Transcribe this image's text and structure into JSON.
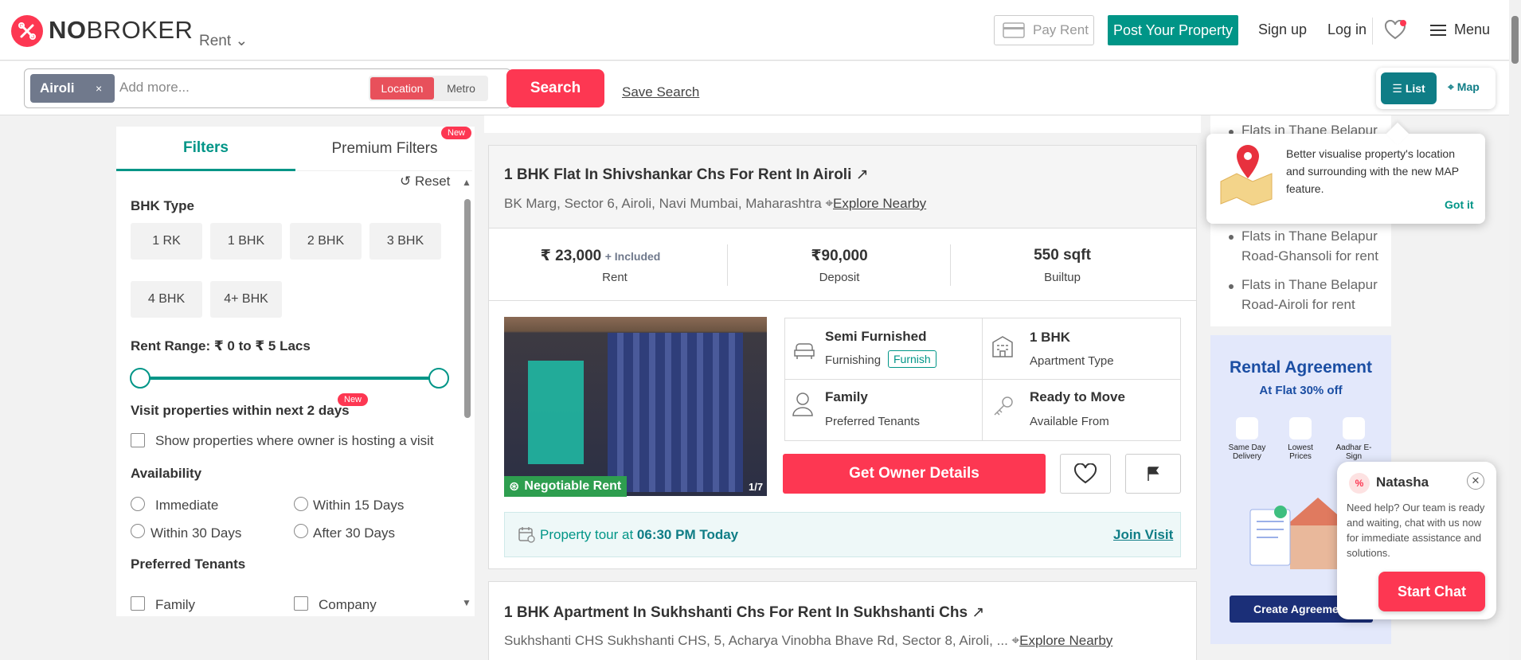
{
  "header": {
    "logo_text_bold": "NO",
    "logo_text_rest": "BROKER",
    "rent_dropdown": "Rent",
    "pay_rent": "Pay Rent",
    "post_property": "Post Your Property",
    "signup": "Sign up",
    "login": "Log in",
    "menu": "Menu"
  },
  "search": {
    "chip": "Airoli",
    "chip_remove": "×",
    "placeholder": "Add more...",
    "toggle_location": "Location",
    "toggle_metro": "Metro",
    "search_button": "Search",
    "save_search": "Save Search"
  },
  "view_toggle": {
    "list": "List",
    "map": "Map"
  },
  "filters": {
    "tab_filters": "Filters",
    "tab_premium": "Premium Filters",
    "new_badge": "New",
    "reset": "Reset",
    "bhk_title": "BHK Type",
    "bhk_options": [
      "1 RK",
      "1 BHK",
      "2 BHK",
      "3 BHK",
      "4 BHK",
      "4+ BHK"
    ],
    "rent_range": "Rent Range: ₹ 0 to ₹ 5 Lacs",
    "visit_title": "Visit properties within next 2 days",
    "visit_new": "New",
    "visit_checkbox": "Show properties where owner is hosting a visit",
    "availability_title": "Availability",
    "availability": [
      "Immediate",
      "Within 15 Days",
      "Within 30 Days",
      "After 30 Days"
    ],
    "tenants_title": "Preferred Tenants",
    "tenants": [
      "Family",
      "Company"
    ]
  },
  "listing1": {
    "title": "1 BHK Flat In Shivshankar Chs For Rent In Airoli",
    "address": "BK Marg, Sector 6, Airoli, Navi Mumbai, Maharashtra",
    "explore": "Explore Nearby",
    "rent_value": "₹ 23,000",
    "rent_included": "+ Included",
    "rent_label": "Rent",
    "deposit_value": "₹90,000",
    "deposit_label": "Deposit",
    "area_value": "550 sqft",
    "area_label": "Builtup",
    "negotiable": "Negotiable Rent",
    "photo_count": "1/7",
    "furnishing_value": "Semi Furnished",
    "furnishing_label": "Furnishing",
    "furnish_tag": "Furnish",
    "apt_value": "1 BHK",
    "apt_label": "Apartment Type",
    "tenant_value": "Family",
    "tenant_label": "Preferred Tenants",
    "avail_value": "Ready to Move",
    "avail_label": "Available From",
    "owner_button": "Get Owner Details",
    "tour_prefix": "Property tour at",
    "tour_time": "06:30 PM Today",
    "join_visit": "Join Visit"
  },
  "listing2": {
    "title": "1 BHK Apartment In Sukhshanti Chs For Rent In Sukhshanti Chs",
    "address": "Sukhshanti CHS  Sukhshanti CHS, 5, Acharya Vinobha Bhave Rd, Sector 8, Airoli, ...",
    "explore": "Explore Nearby"
  },
  "sidebar": {
    "links": [
      "Flats in Thane Belapur",
      "Flats in Thane Belapur Road-Ghansoli for rent",
      "Flats in Thane Belapur Road-Airoli for rent"
    ],
    "promo_title": "Rental Agreement",
    "promo_sub": "At Flat 30% off",
    "promo_features": [
      "Same Day Delivery",
      "Lowest Prices",
      "Aadhar E-Sign"
    ],
    "promo_cta": "Create Agreement"
  },
  "tooltip": {
    "text": "Better visualise property's location and surrounding with the new MAP feature.",
    "got_it": "Got it"
  },
  "chat": {
    "name": "Natasha",
    "message": "Need help? Our team is ready and waiting, chat with us now for immediate assistance and solutions.",
    "button": "Start Chat"
  },
  "colors": {
    "brand": "#fd3752",
    "teal": "#009587"
  }
}
